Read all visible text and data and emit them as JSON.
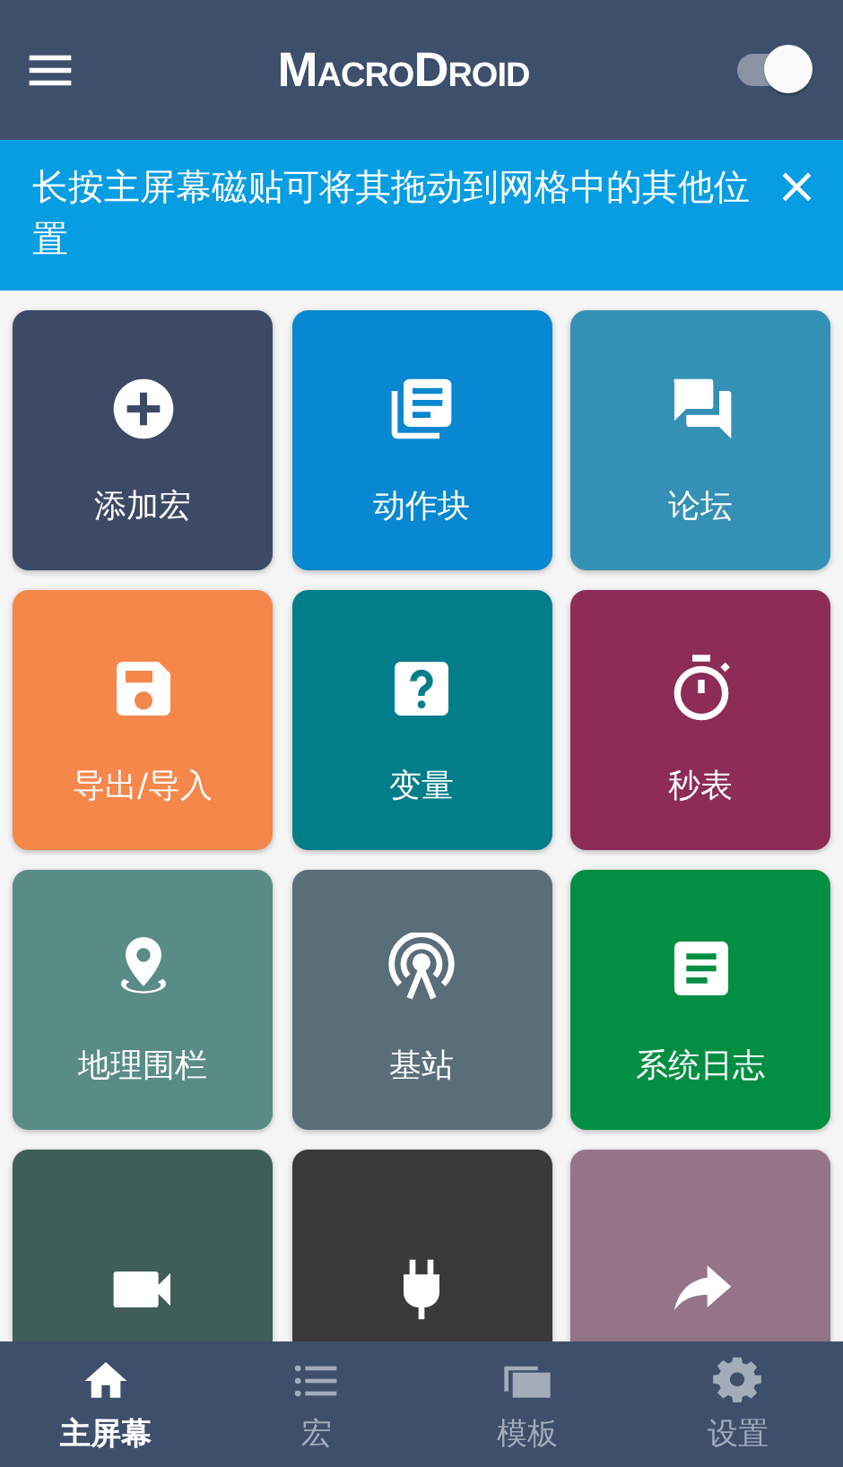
{
  "app_bar": {
    "title": "MacroDroid",
    "toggle": {
      "on": true
    }
  },
  "banner": {
    "text": "长按主屏幕磁贴可将其拖动到网格中的其他位置",
    "close": "×"
  },
  "tiles": [
    {
      "label": "添加宏",
      "color": "#3d4a66"
    },
    {
      "label": "动作块",
      "color": "#0788d0"
    },
    {
      "label": "论坛",
      "color": "#3590b5"
    },
    {
      "label": "导出/导入",
      "color": "#f5874a"
    },
    {
      "label": "变量",
      "color": "#027d8a"
    },
    {
      "label": "秒表",
      "color": "#8c2c57"
    },
    {
      "label": "地理围栏",
      "color": "#5a8c87"
    },
    {
      "label": "基站",
      "color": "#5a6e7a"
    },
    {
      "label": "系统日志",
      "color": "#038f43"
    },
    {
      "color": "#3f5e57"
    },
    {
      "color": "#393939"
    },
    {
      "color": "#957489"
    }
  ],
  "bottom_nav": [
    {
      "label": "主屏幕",
      "selected": true
    },
    {
      "label": "宏",
      "selected": false
    },
    {
      "label": "模板",
      "selected": false
    },
    {
      "label": "设置",
      "selected": false
    }
  ]
}
